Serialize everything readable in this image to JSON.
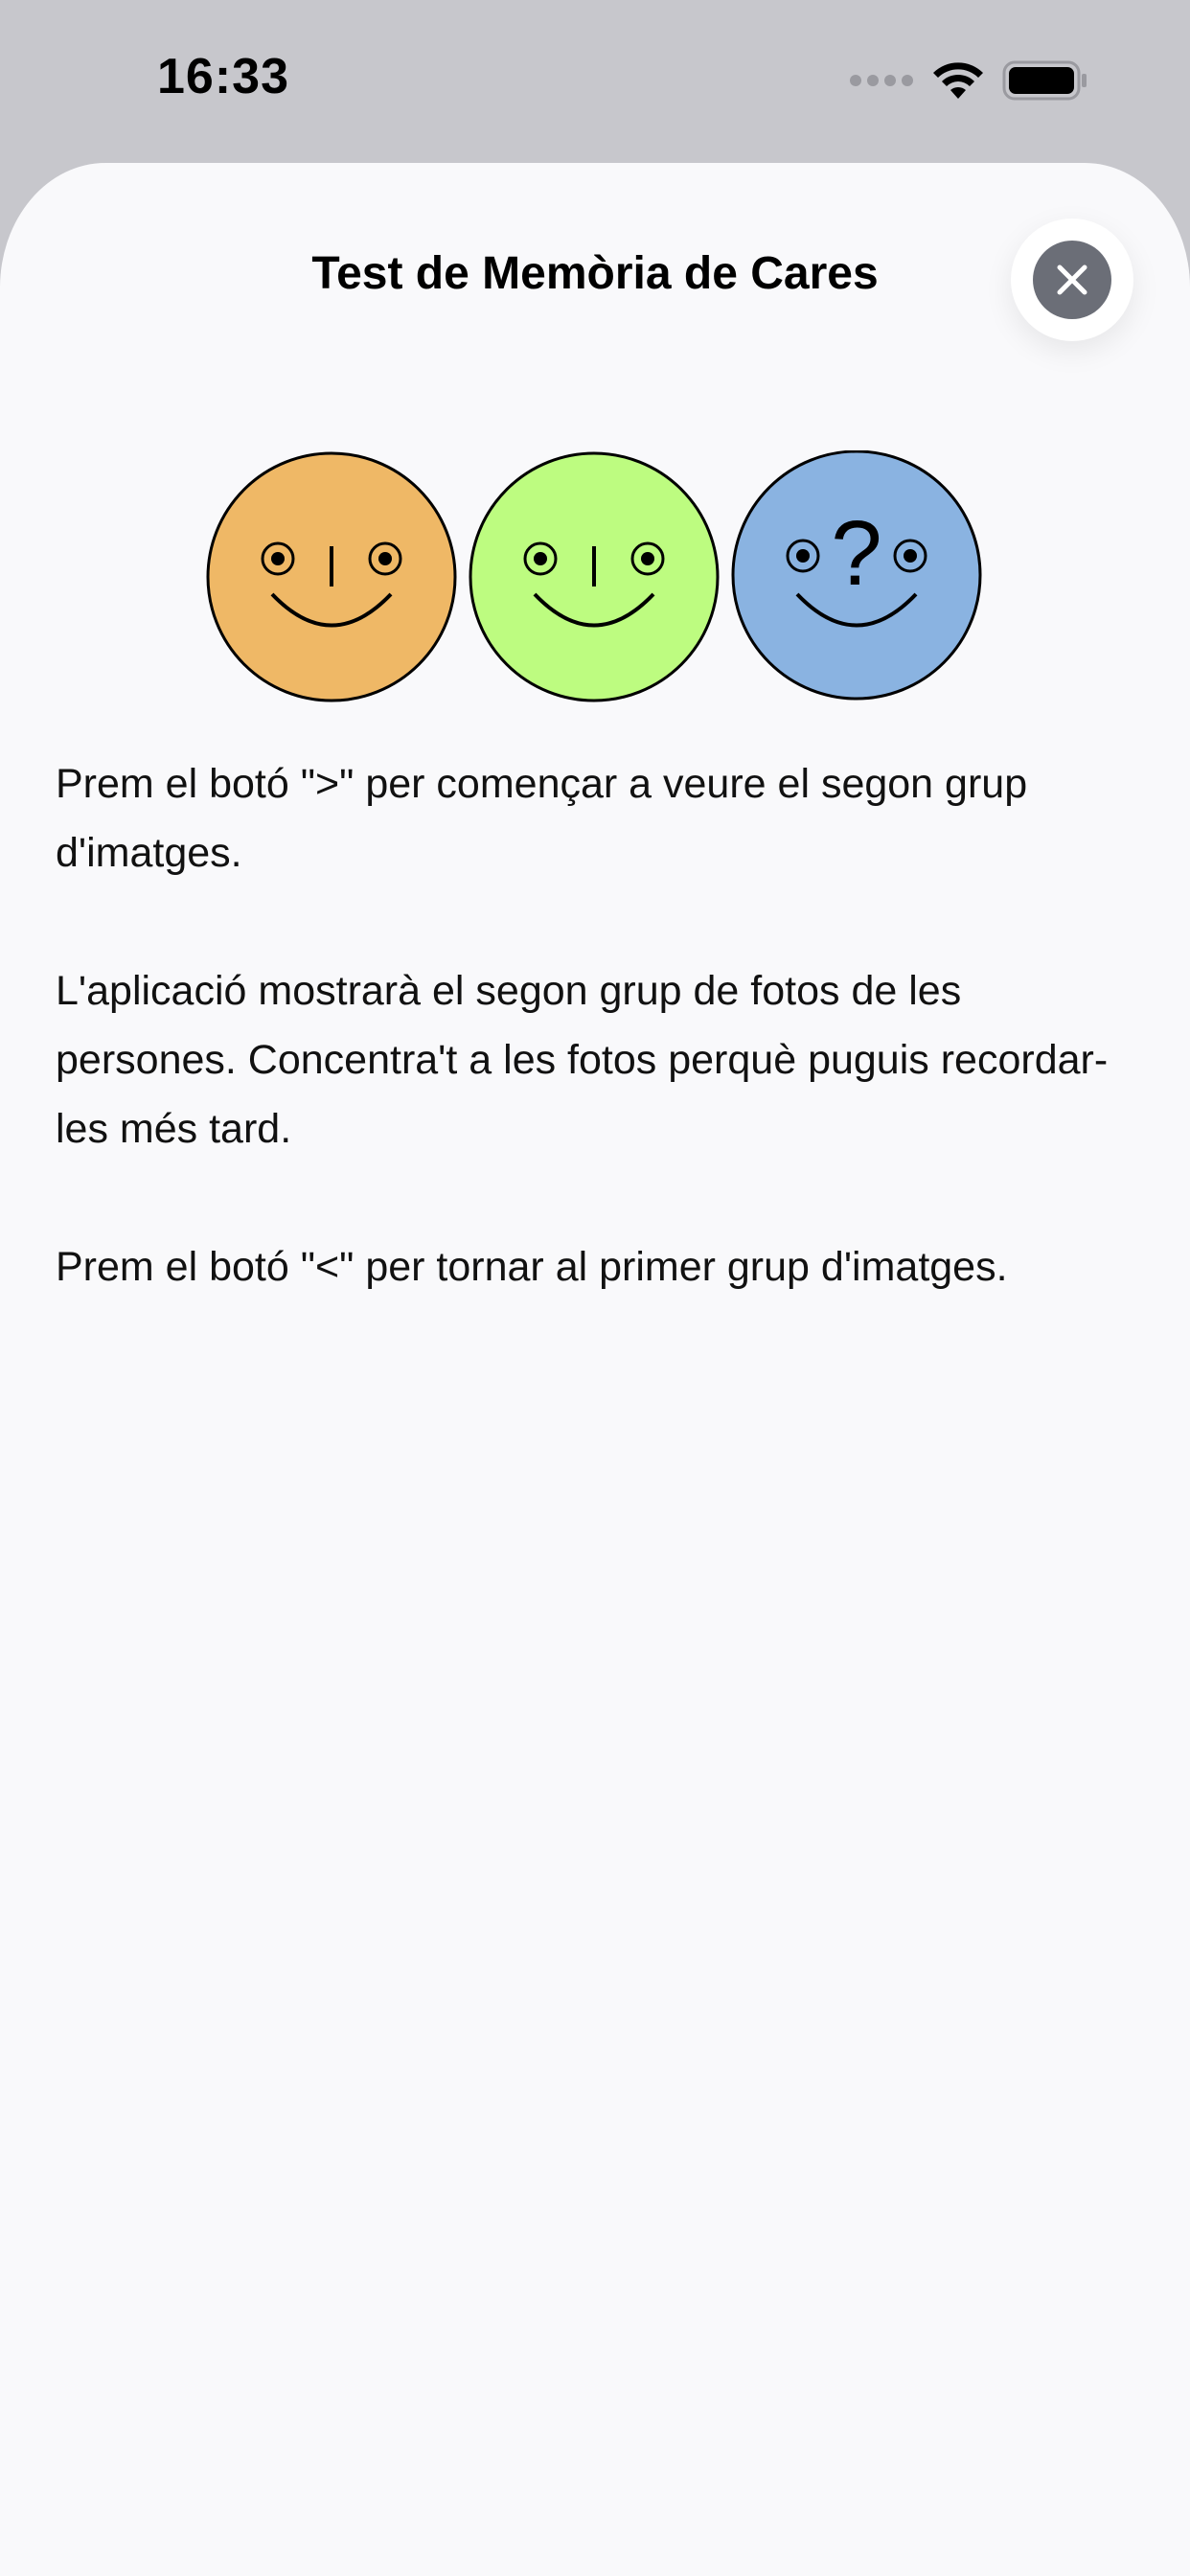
{
  "status_bar": {
    "time": "16:33",
    "icons": [
      "signal-dots-icon",
      "wifi-icon",
      "battery-icon"
    ]
  },
  "sheet": {
    "title": "Test de Memòria de Cares",
    "close_icon": "close-icon"
  },
  "faces": [
    {
      "name": "face-orange",
      "color": "#efb866",
      "has_question_mark": false
    },
    {
      "name": "face-green",
      "color": "#bdfc80",
      "has_question_mark": false
    },
    {
      "name": "face-blue",
      "color": "#8ab3e1",
      "has_question_mark": true,
      "question_mark": "?"
    }
  ],
  "instructions": [
    "Prem el botó \">\" per començar a veure el segon grup d'imatges.",
    "L'aplicació mostrarà el segon grup de fotos de les persones. Concentra't a les fotos perquè puguis recordar-les més tard.",
    "Prem el botó \"<\" per tornar al primer grup d'imatges."
  ]
}
